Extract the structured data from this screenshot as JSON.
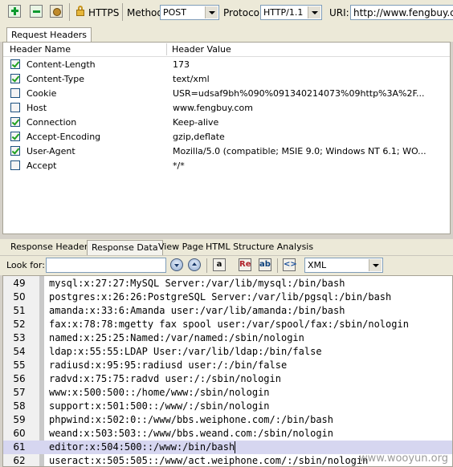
{
  "toolbar": {
    "https_label": "HTTPS",
    "method_label": "Method:",
    "method_value": "POST",
    "protocol_label": "Protocol:",
    "protocol_value": "HTTP/1.1",
    "uri_label": "URI:",
    "uri_value": "http://www.fengbuy.com"
  },
  "request_tabs": [
    "Request Headers"
  ],
  "request_headers": {
    "col_name": "Header Name",
    "col_value": "Header Value",
    "rows": [
      {
        "name": "Content-Length",
        "value": "173",
        "checked": true
      },
      {
        "name": "Content-Type",
        "value": "text/xml",
        "checked": true
      },
      {
        "name": "Cookie",
        "value": "USR=udsaf9bh%090%091340214073%09http%3A%2F...",
        "checked": false
      },
      {
        "name": "Host",
        "value": "www.fengbuy.com",
        "checked": false
      },
      {
        "name": "Connection",
        "value": "Keep-alive",
        "checked": true
      },
      {
        "name": "Accept-Encoding",
        "value": "gzip,deflate",
        "checked": true
      },
      {
        "name": "User-Agent",
        "value": "Mozilla/5.0 (compatible; MSIE 9.0; Windows NT 6.1; WO...",
        "checked": true
      },
      {
        "name": "Accept",
        "value": "*/*",
        "checked": false
      }
    ]
  },
  "response_tabs": [
    "Response Headers",
    "Response Data",
    "View Page",
    "HTML Structure Analysis"
  ],
  "find_bar": {
    "look_label": "Look for:",
    "look_value": "",
    "format_value": "XML",
    "icon_a": "a",
    "icon_re": "Re",
    "icon_ab": "ab"
  },
  "code_lines": [
    {
      "num": "49",
      "text": "mysql:x:27:27:MySQL Server:/var/lib/mysql:/bin/bash"
    },
    {
      "num": "50",
      "text": "postgres:x:26:26:PostgreSQL Server:/var/lib/pgsql:/bin/bash"
    },
    {
      "num": "51",
      "text": "amanda:x:33:6:Amanda user:/var/lib/amanda:/bin/bash"
    },
    {
      "num": "52",
      "text": "fax:x:78:78:mgetty fax spool user:/var/spool/fax:/sbin/nologin"
    },
    {
      "num": "53",
      "text": "named:x:25:25:Named:/var/named:/sbin/nologin"
    },
    {
      "num": "54",
      "text": "ldap:x:55:55:LDAP User:/var/lib/ldap:/bin/false"
    },
    {
      "num": "55",
      "text": "radiusd:x:95:95:radiusd user:/:/bin/false"
    },
    {
      "num": "56",
      "text": "radvd:x:75:75:radvd user:/:/sbin/nologin"
    },
    {
      "num": "57",
      "text": "www:x:500:500::/home/www:/sbin/nologin"
    },
    {
      "num": "58",
      "text": "support:x:501:500::/www/:/sbin/nologin"
    },
    {
      "num": "59",
      "text": "phpwind:x:502:0::/www/bbs.weiphone.com/:/bin/bash"
    },
    {
      "num": "60",
      "text": "weand:x:503:503::/www/bbs.weand.com:/sbin/nologin"
    },
    {
      "num": "61",
      "text": "editor:x:504:500::/www:/bin/bash"
    },
    {
      "num": "62",
      "text": "useract:x:505:505::/www/act.weiphone.com/:/sbin/nologin"
    }
  ],
  "watermark": "www.wooyun.org"
}
